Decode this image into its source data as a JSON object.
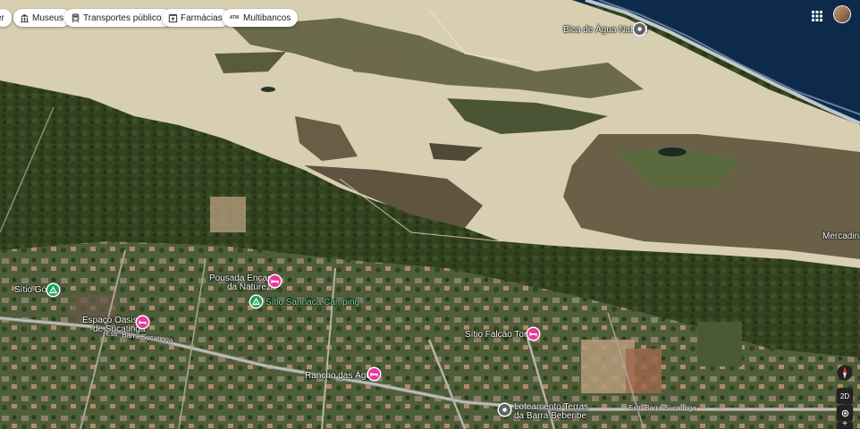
{
  "chips": [
    {
      "label": "er",
      "icon": "none"
    },
    {
      "label": "Museus",
      "icon": "museum-icon"
    },
    {
      "label": "Transportes públicos",
      "icon": "train-icon"
    },
    {
      "label": "Farmácias",
      "icon": "pharmacy-icon"
    },
    {
      "label": "Multibancos",
      "icon": "atm-icon",
      "icon_text": "ATM"
    }
  ],
  "places": {
    "bica": "Bica de Água Natural",
    "mercadinho": "Mercadinh",
    "sitio_gois": "Sítio Góis",
    "pousada_l1": "Pousada Encanto",
    "pousada_l2": "da Natureza",
    "sitio_sannaca": "Sítio Sannaca Camping",
    "espaco_l1": "Espaço Oasis",
    "espaco_l2": "de Sucatinga",
    "sitio_falcao": "Sítio Falcão Torres",
    "rancho": "Rancho das Águas",
    "loteamento_l1": "Loteamento Terras",
    "loteamento_l2": "da Barra Beberibe"
  },
  "roads": {
    "road1": "Estr. Barra Sucatinga",
    "road2": "Estr. Barra Sucatinga"
  },
  "controls": {
    "view_mode": "2D"
  },
  "colors": {
    "hotel_pin": "#e6399b",
    "camp_pin": "#1e9e5a",
    "ocean": "#0d2a4a",
    "sand": "#d8cfb2"
  }
}
